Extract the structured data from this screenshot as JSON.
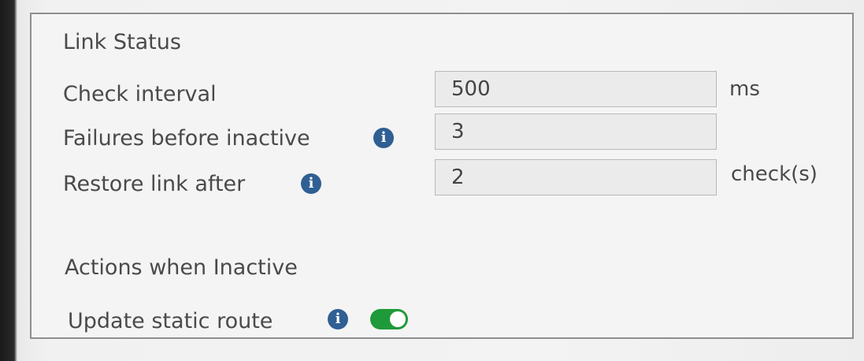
{
  "link_status": {
    "title": "Link Status",
    "check_interval": {
      "label": "Check interval",
      "value": "500",
      "unit": "ms"
    },
    "failures_before_inactive": {
      "label": "Failures before inactive",
      "value": "3",
      "info_icon": "info-icon"
    },
    "restore_link_after": {
      "label": "Restore link after",
      "value": "2",
      "unit": "check(s)",
      "info_icon": "info-icon"
    }
  },
  "actions_when_inactive": {
    "title": "Actions when Inactive",
    "update_static_route": {
      "label": "Update static route",
      "enabled": true,
      "info_icon": "info-icon"
    }
  },
  "colors": {
    "toggle_on": "#1f9a3a",
    "info_icon": "#2f5f93"
  }
}
